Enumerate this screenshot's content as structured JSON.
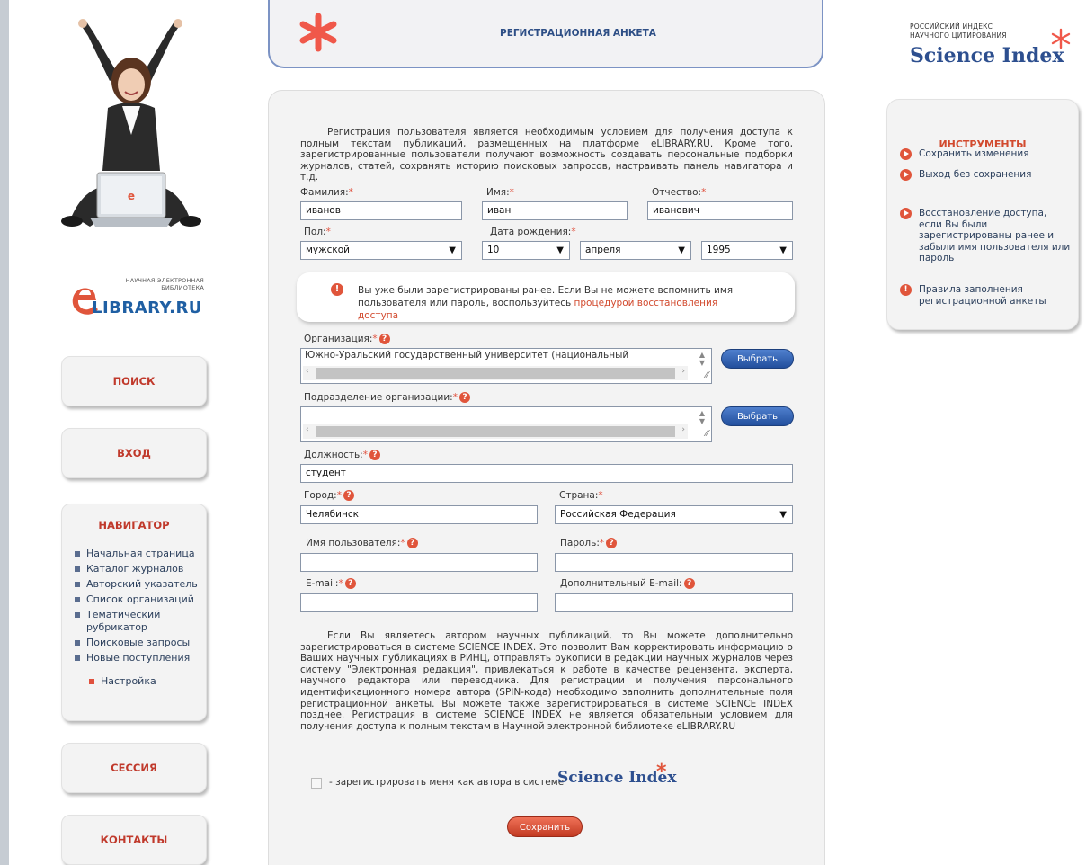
{
  "header": {
    "title": "РЕГИСТРАЦИОННАЯ АНКЕТА"
  },
  "logo_elibrary": {
    "line1": "НАУЧНАЯ ЭЛЕКТРОННАЯ",
    "line2": "БИБЛИОТЕКА",
    "name": "LIBRARY.RU"
  },
  "logo_science_index": {
    "line1": "РОССИЙСКИЙ ИНДЕКС",
    "line2": "НАУЧНОГО ЦИТИРОВАНИЯ",
    "name": "Science Index"
  },
  "left_nav": {
    "search": "ПОИСК",
    "login": "ВХОД",
    "navigator_title": "НАВИГАТОР",
    "items": [
      "Начальная страница",
      "Каталог журналов",
      "Авторский указатель",
      "Список организаций",
      "Тематический рубрикатор",
      "Поисковые запросы",
      "Новые поступления"
    ],
    "settings": "Настройка",
    "session": "СЕССИЯ",
    "contacts": "КОНТАКТЫ"
  },
  "form": {
    "intro": "Регистрация пользователя является необходимым условием для получения доступа к полным текстам публикаций, размещенных на платформе eLIBRARY.RU. Кроме того, зарегистрированные пользователи получают возможность создавать персональные подборки журналов, статей, сохранять историю поисковых запросов, настраивать панель навигатора и т.д.",
    "surname_label": "Фамилия:",
    "surname_value": "иванов",
    "name_label": "Имя:",
    "name_value": "иван",
    "patronymic_label": "Отчество:",
    "patronymic_value": "иванович",
    "gender_label": "Пол:",
    "gender_value": "мужской",
    "birth_label": "Дата рождения:",
    "birth_day": "10",
    "birth_month": "апреля",
    "birth_year": "1995",
    "notice_text": "Вы уже были зарегистрированы ранее. Если Вы не можете вспомнить имя пользователя или пароль, воспользуйтесь ",
    "notice_link": "процедурой восстановления доступа",
    "org_label": "Организация:",
    "org_value": "Южно-Уральский государственный университет (национальный",
    "choose_button": "Выбрать",
    "dept_label": "Подразделение организации:",
    "position_label": "Должность:",
    "position_value": "студент",
    "city_label": "Город:",
    "city_value": "Челябинск",
    "country_label": "Страна:",
    "country_value": "Российская Федерация",
    "username_label": "Имя пользователя:",
    "password_label": "Пароль:",
    "email_label": "E-mail:",
    "extra_email_label": "Дополнительный E-mail:",
    "author_paragraph": "Если Вы являетесь автором научных публикаций, то Вы можете дополнительно зарегистрироваться в системе SCIENCE INDEX. Это позволит Вам корректировать информацию о Ваших научных публикациях в РИНЦ, отправлять рукописи в редакции научных журналов через систему \"Электронная редакция\", привлекаться к работе в качестве рецензента, эксперта, научного редактора или переводчика. Для регистрации и получения персонального идентификационного номера автора (SPIN-кода) необходимо заполнить дополнительные поля регистрационной анкеты. Вы можете также зарегистрироваться в системе SCIENCE INDEX позднее. Регистрация в системе SCIENCE INDEX не является обязательным условием для получения доступа к полным текстам в Научной электронной библиотеке eLIBRARY.RU",
    "register_author_label": "- зарегистрировать меня как автора в системе",
    "science_index_text": "Science Index",
    "save_button": "Сохранить"
  },
  "tools": {
    "title": "ИНСТРУМЕНТЫ",
    "save": "Сохранить изменения",
    "exit": "Выход без сохранения",
    "restore": "Восстановление доступа, если Вы были зарегистрированы ранее и забыли имя пользователя или пароль",
    "rules": "Правила заполнения регистрационной анкеты"
  },
  "colors": {
    "accent_red": "#e0553b",
    "brand_blue": "#2d4f8f",
    "panel": "#f3f3f3"
  }
}
